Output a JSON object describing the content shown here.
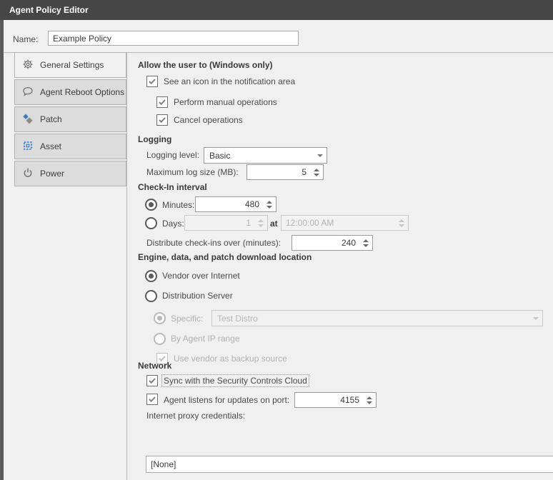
{
  "window": {
    "title": "Agent Policy Editor"
  },
  "name_row": {
    "label": "Name:",
    "value": "Example Policy"
  },
  "sidebar": {
    "tabs": [
      {
        "label": "General Settings",
        "icon": "gear-icon",
        "selected": true
      },
      {
        "label": "Agent Reboot Options",
        "icon": "speech-bubble-icon",
        "selected": false
      },
      {
        "label": "Patch",
        "icon": "patch-diamonds-icon",
        "selected": false
      },
      {
        "label": "Asset",
        "icon": "chip-icon",
        "selected": false
      },
      {
        "label": "Power",
        "icon": "power-icon",
        "selected": false
      }
    ]
  },
  "general": {
    "allow_header": "Allow the user to (Windows only)",
    "cb_notification": "See an icon in the notification area",
    "cb_manual": "Perform manual operations",
    "cb_cancel": "Cancel operations",
    "logging_header": "Logging",
    "logging_level_label": "Logging level:",
    "logging_level_value": "Basic",
    "max_log_label": "Maximum log size (MB):",
    "max_log_value": "5",
    "checkin_header": "Check-In interval",
    "minutes_label": "Minutes:",
    "minutes_value": "480",
    "days_label": "Days:",
    "days_value": "1",
    "at_label": "at",
    "time_value": "12:00:00 AM",
    "distribute_label": "Distribute check-ins over (minutes):",
    "distribute_value": "240",
    "engine_header": "Engine, data, and patch download location",
    "vendor_label": "Vendor over Internet",
    "dist_server_label": "Distribution Server",
    "specific_label": "Specific:",
    "specific_value": "Test Distro",
    "ip_range_label": "By Agent IP range",
    "backup_label": "Use vendor as backup source",
    "network_header": "Network",
    "sync_label": "Sync with the Security Controls Cloud",
    "port_label": "Agent listens for updates on port:",
    "port_value": "4155",
    "proxy_label": "Internet proxy credentials:",
    "proxy_value": "[None]"
  },
  "colors": {
    "titlebar_bg": "#464646",
    "tab_bg": "#dcdcdc",
    "tab_selected_bg": "#f2f2f2",
    "accent_blue": "#2e74d3",
    "patch_blue": "#3c79c4",
    "checkmark_gray": "#7f7f7f"
  }
}
